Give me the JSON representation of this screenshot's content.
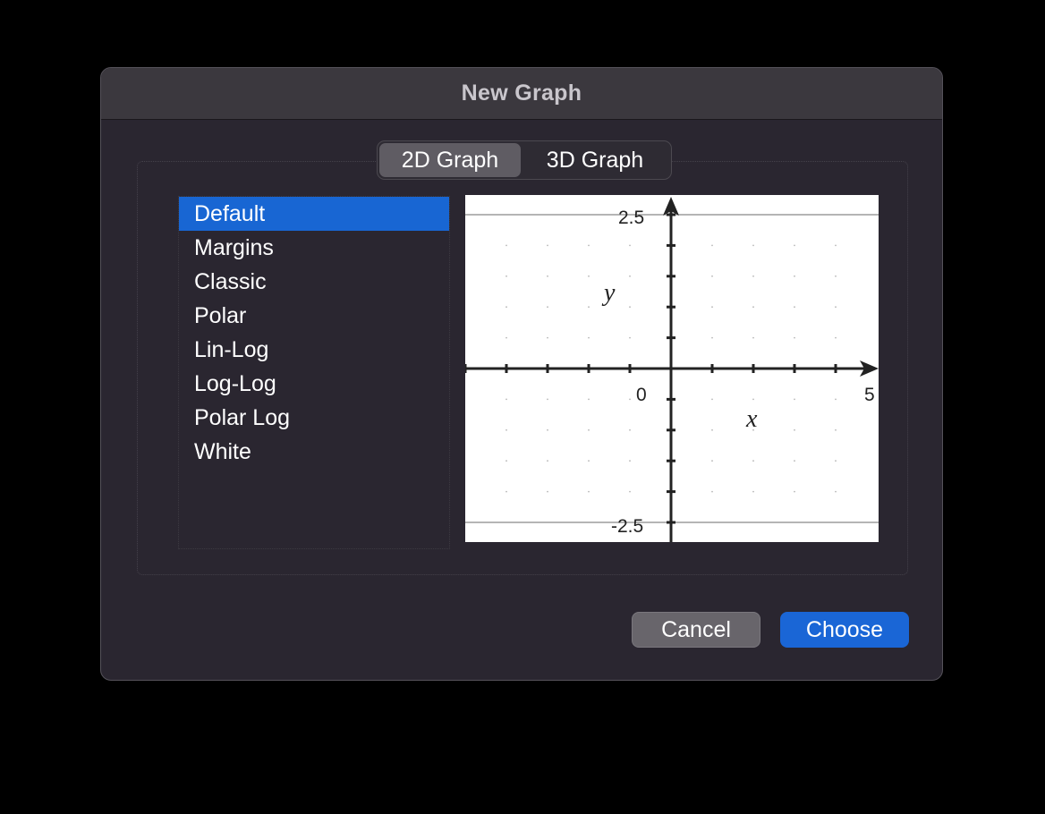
{
  "window": {
    "title": "New Graph"
  },
  "tabs": [
    {
      "label": "2D Graph",
      "active": true
    },
    {
      "label": "3D Graph",
      "active": false
    }
  ],
  "templates": [
    {
      "label": "Default",
      "selected": true
    },
    {
      "label": "Margins",
      "selected": false
    },
    {
      "label": "Classic",
      "selected": false
    },
    {
      "label": "Polar",
      "selected": false
    },
    {
      "label": "Lin-Log",
      "selected": false
    },
    {
      "label": "Log-Log",
      "selected": false
    },
    {
      "label": "Polar Log",
      "selected": false
    },
    {
      "label": "White",
      "selected": false
    }
  ],
  "preview": {
    "x_axis_label": "x",
    "y_axis_label": "y",
    "origin_label": "0",
    "x_max_label": "5",
    "y_max_label": "2.5",
    "y_min_label": "-2.5",
    "x_range": [
      -5,
      5
    ],
    "y_range": [
      -2.5,
      2.5
    ]
  },
  "buttons": {
    "cancel": "Cancel",
    "choose": "Choose"
  },
  "colors": {
    "selection": "#1866d3",
    "primary_button": "#1a66d6",
    "window_background": "#2a2630"
  }
}
